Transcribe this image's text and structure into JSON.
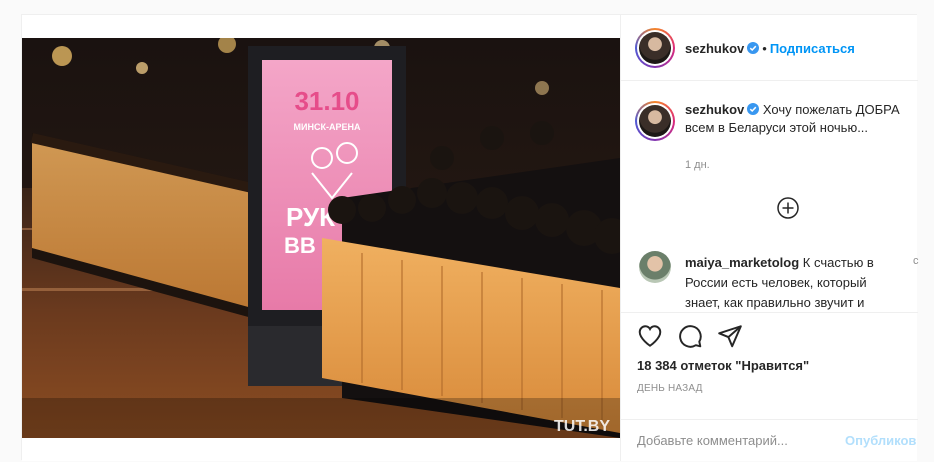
{
  "post": {
    "watermark": "TUT.BY",
    "poster": {
      "date": "31.10",
      "venue": "МИНСК-АРЕНА",
      "big_text_1": "РУК",
      "big_text_2": "ВВ"
    }
  },
  "header": {
    "username": "sezhukov",
    "separator": "•",
    "follow_label": "Подписаться"
  },
  "caption": {
    "username": "sezhukov",
    "text": "Хочу пожелать ДОБРА всем в Беларуси этой ночью...",
    "time": "1 дн."
  },
  "comment": {
    "username": "maiya_marketolog",
    "text": "К счастью в России есть человек, который знает, как правильно звучит и",
    "more": "c"
  },
  "stats": {
    "likes": "18 384 отметок \"Нравится\"",
    "ago": "ДЕНЬ НАЗАД"
  },
  "composer": {
    "placeholder": "Добавьте комментарий...",
    "publish_label": "Опубликов"
  },
  "icons": [
    "verified-icon",
    "plus-circle-icon",
    "heart-icon",
    "comment-icon",
    "share-icon"
  ],
  "colors": {
    "link": "#0095f6",
    "muted": "#8e8e8e",
    "publish_disabled": "#b2dffc"
  }
}
